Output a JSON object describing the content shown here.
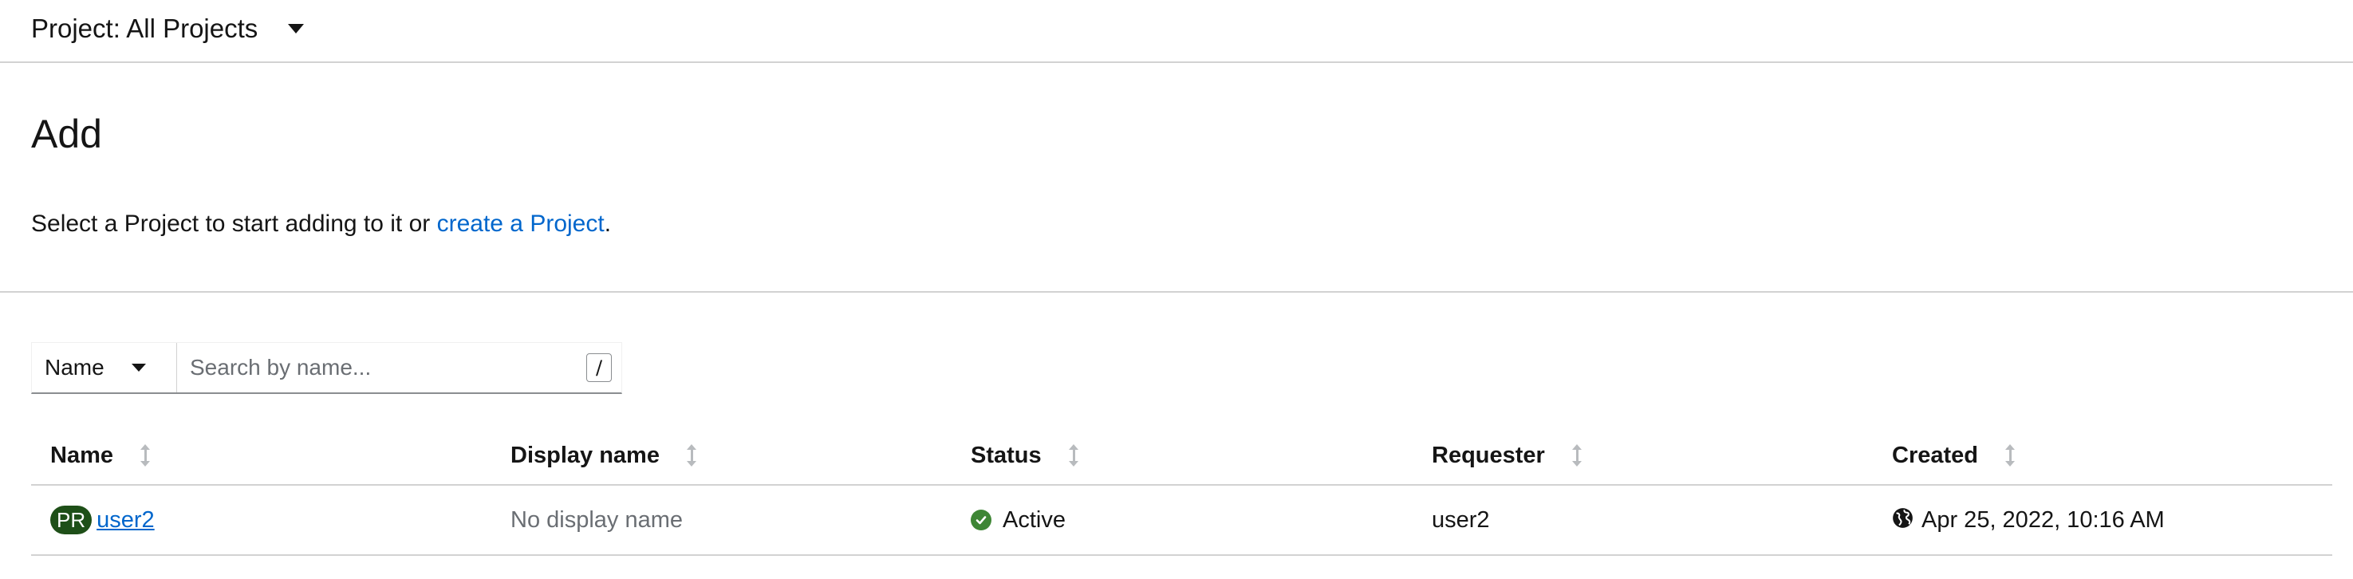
{
  "project_bar": {
    "label": "Project: All Projects",
    "icon": "caret-down-icon"
  },
  "page": {
    "title": "Add",
    "help_prefix": "Select a Project to start adding to it or ",
    "help_link": "create a Project",
    "help_suffix": "."
  },
  "filter": {
    "type": "Name",
    "placeholder": "Search by name...",
    "shortcut_hint": "/"
  },
  "table": {
    "columns": [
      "Name",
      "Display name",
      "Status",
      "Requester",
      "Created"
    ],
    "rows": [
      {
        "badge": "PR",
        "name": "user2",
        "display_name": "No display name",
        "status": "Active",
        "requester": "user2",
        "created": "Apr 25, 2022, 10:16 AM"
      }
    ]
  },
  "colors": {
    "link": "#0066cc",
    "badge": "#1e4f18",
    "status_active": "#3e8635",
    "border": "#d2d2d2"
  }
}
